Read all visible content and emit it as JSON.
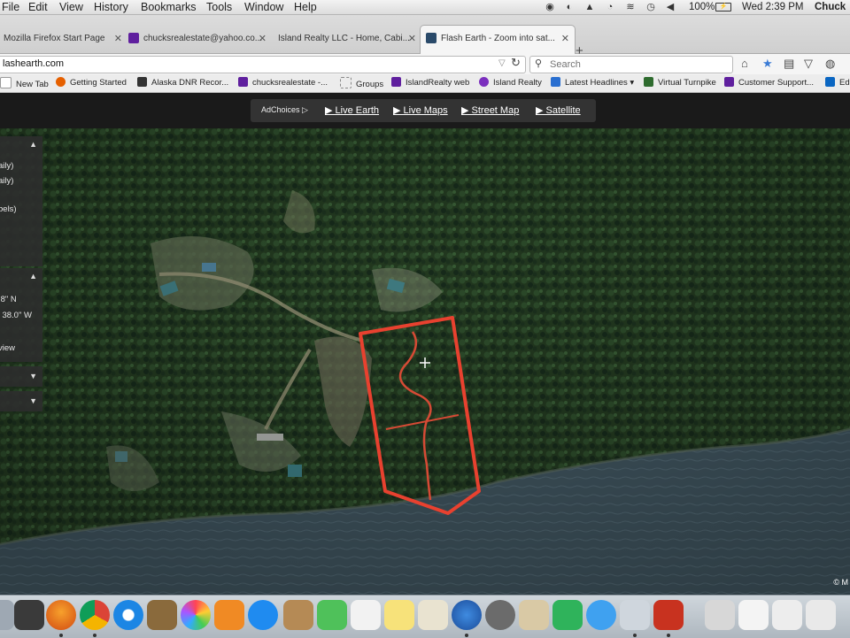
{
  "menubar": {
    "items": [
      "File",
      "Edit",
      "View",
      "History",
      "Bookmarks",
      "Tools",
      "Window",
      "Help"
    ],
    "battery": "100%",
    "clock": "Wed 2:39 PM",
    "user": "Chuck"
  },
  "tabs": [
    {
      "label": "Mozilla Firefox Start Page",
      "active": false
    },
    {
      "label": "chucksrealestate@yahoo.co...",
      "active": false
    },
    {
      "label": "Island Realty LLC - Home, Cabi...",
      "active": false
    },
    {
      "label": "Flash Earth - Zoom into sat...",
      "active": true
    }
  ],
  "navbar": {
    "url": "lashearth.com",
    "search_placeholder": "Search"
  },
  "bookmarks": [
    "New Tab",
    "Getting Started",
    "Alaska DNR Recor...",
    "chucksrealestate -...",
    "Groups",
    "IslandRealty web",
    "Island Realty",
    "Latest Headlines",
    "Virtual Turnpike",
    "Customer Support...",
    "Ed"
  ],
  "site": {
    "adchoices": "AdChoices",
    "links": [
      "▶ Live Earth",
      "▶ Live Maps",
      "▶ Street Map",
      "▶ Satellite"
    ]
  },
  "panels": {
    "top_lines": [
      "aily)",
      "aily)",
      "bels)"
    ],
    "coord_lines": [
      ".8\" N",
      "' 38.0\" W",
      "view"
    ]
  },
  "copyright": "© M",
  "colors": {
    "boundary": "#e8412f",
    "forest": "#1f3320",
    "water": "#3f5560"
  }
}
